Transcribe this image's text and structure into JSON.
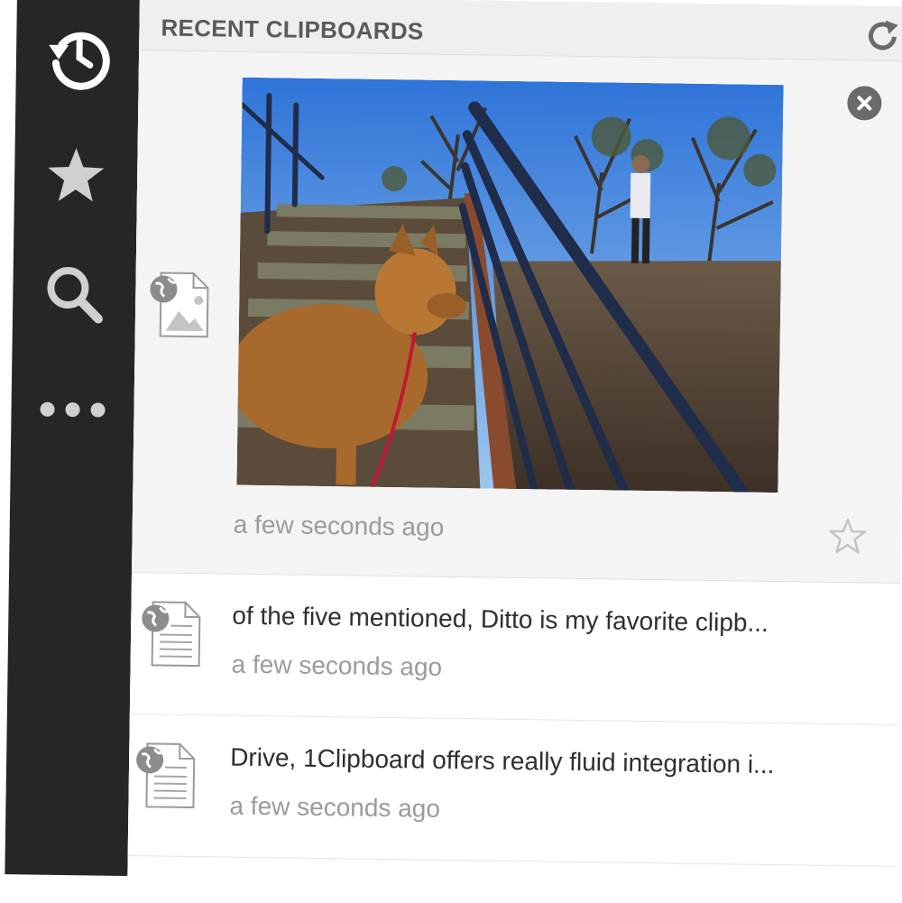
{
  "sidebar": {
    "items": [
      {
        "name": "history-icon"
      },
      {
        "name": "star-icon"
      },
      {
        "name": "search-icon"
      },
      {
        "name": "more-icon"
      }
    ]
  },
  "header": {
    "title": "RECENT CLIPBOARDS",
    "refresh_icon": "refresh-icon"
  },
  "clips": [
    {
      "type": "image",
      "icon": "web-image-icon",
      "timestamp": "a few seconds ago"
    },
    {
      "type": "text",
      "icon": "web-document-icon",
      "text": "of the five mentioned, Ditto is my favorite clipb...",
      "timestamp": "a few seconds ago"
    },
    {
      "type": "text",
      "icon": "web-document-icon",
      "text": "Drive, 1Clipboard offers really fluid integration i...",
      "timestamp": "a few seconds ago"
    }
  ],
  "colors": {
    "sidebar": "#262626",
    "header": "#efefef",
    "accent_gray": "#6a6a6a"
  }
}
